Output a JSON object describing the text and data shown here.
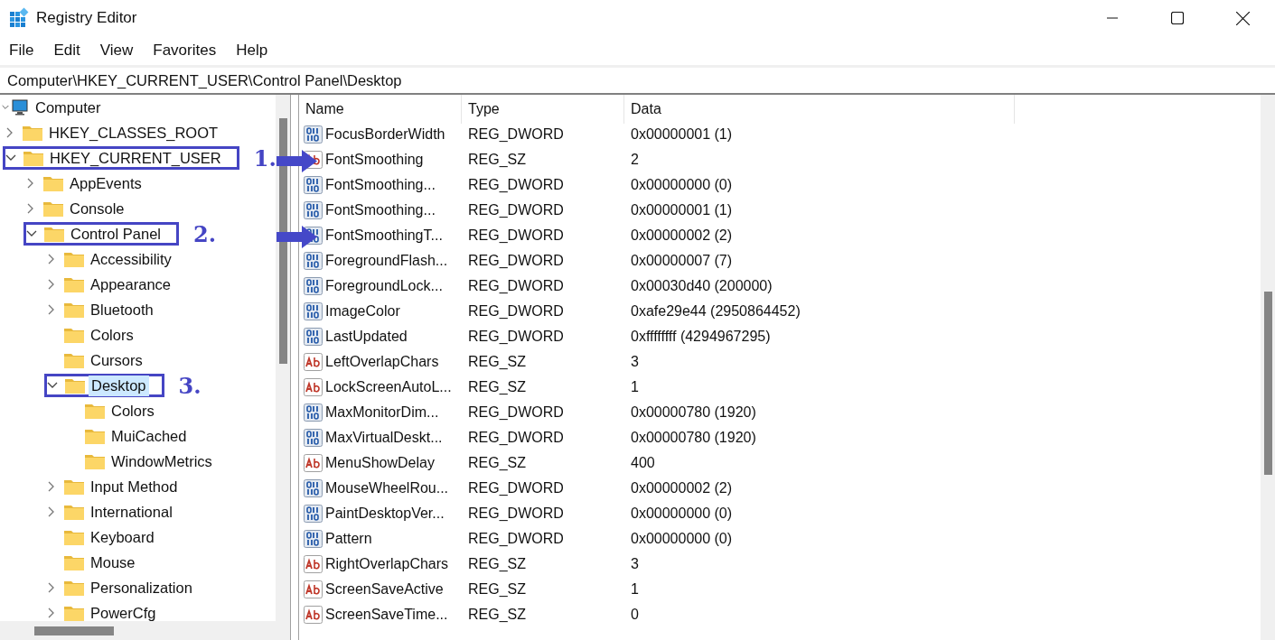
{
  "window": {
    "title": "Registry Editor"
  },
  "menu": [
    "File",
    "Edit",
    "View",
    "Favorites",
    "Help"
  ],
  "address": "Computer\\HKEY_CURRENT_USER\\Control Panel\\Desktop",
  "tree": [
    {
      "label": "Computer",
      "kind": "computer",
      "has_children": true,
      "expanded": true,
      "selected": false,
      "children": [
        {
          "label": "HKEY_CLASSES_ROOT",
          "kind": "folder",
          "has_children": true,
          "expanded": false,
          "selected": false
        },
        {
          "label": "HKEY_CURRENT_USER",
          "kind": "folder",
          "has_children": true,
          "expanded": true,
          "selected": false,
          "annotation": "1.",
          "children": [
            {
              "label": "AppEvents",
              "kind": "folder",
              "has_children": true,
              "expanded": false,
              "selected": false
            },
            {
              "label": "Console",
              "kind": "folder",
              "has_children": true,
              "expanded": false,
              "selected": false
            },
            {
              "label": "Control Panel",
              "kind": "folder",
              "has_children": true,
              "expanded": true,
              "selected": false,
              "annotation": "2.",
              "children": [
                {
                  "label": "Accessibility",
                  "kind": "folder",
                  "has_children": true,
                  "expanded": false,
                  "selected": false
                },
                {
                  "label": "Appearance",
                  "kind": "folder",
                  "has_children": true,
                  "expanded": false,
                  "selected": false
                },
                {
                  "label": "Bluetooth",
                  "kind": "folder",
                  "has_children": true,
                  "expanded": false,
                  "selected": false
                },
                {
                  "label": "Colors",
                  "kind": "folder",
                  "has_children": false,
                  "selected": false
                },
                {
                  "label": "Cursors",
                  "kind": "folder",
                  "has_children": false,
                  "selected": false
                },
                {
                  "label": "Desktop",
                  "kind": "folder",
                  "has_children": true,
                  "expanded": true,
                  "selected": true,
                  "annotation": "3.",
                  "children": [
                    {
                      "label": "Colors",
                      "kind": "folder",
                      "has_children": false,
                      "selected": false
                    },
                    {
                      "label": "MuiCached",
                      "kind": "folder",
                      "has_children": false,
                      "selected": false
                    },
                    {
                      "label": "WindowMetrics",
                      "kind": "folder",
                      "has_children": false,
                      "selected": false
                    }
                  ]
                },
                {
                  "label": "Input Method",
                  "kind": "folder",
                  "has_children": true,
                  "expanded": false,
                  "selected": false
                },
                {
                  "label": "International",
                  "kind": "folder",
                  "has_children": true,
                  "expanded": false,
                  "selected": false
                },
                {
                  "label": "Keyboard",
                  "kind": "folder",
                  "has_children": false,
                  "selected": false
                },
                {
                  "label": "Mouse",
                  "kind": "folder",
                  "has_children": false,
                  "selected": false
                },
                {
                  "label": "Personalization",
                  "kind": "folder",
                  "has_children": true,
                  "expanded": false,
                  "selected": false
                },
                {
                  "label": "PowerCfg",
                  "kind": "folder",
                  "has_children": true,
                  "expanded": false,
                  "selected": false
                }
              ]
            }
          ]
        }
      ]
    }
  ],
  "columns": [
    "Name",
    "Type",
    "Data"
  ],
  "values": [
    {
      "name": "FocusBorderWidth",
      "kind": "binary",
      "type": "REG_DWORD",
      "data": "0x00000001 (1)",
      "arrow": false
    },
    {
      "name": "FontSmoothing",
      "kind": "string",
      "type": "REG_SZ",
      "data": "2",
      "arrow": true
    },
    {
      "name": "FontSmoothing...",
      "kind": "binary",
      "type": "REG_DWORD",
      "data": "0x00000000 (0)",
      "arrow": false
    },
    {
      "name": "FontSmoothing...",
      "kind": "binary",
      "type": "REG_DWORD",
      "data": "0x00000001 (1)",
      "arrow": false
    },
    {
      "name": "FontSmoothingT...",
      "kind": "binary",
      "type": "REG_DWORD",
      "data": "0x00000002 (2)",
      "arrow": true
    },
    {
      "name": "ForegroundFlash...",
      "kind": "binary",
      "type": "REG_DWORD",
      "data": "0x00000007 (7)",
      "arrow": false
    },
    {
      "name": "ForegroundLock...",
      "kind": "binary",
      "type": "REG_DWORD",
      "data": "0x00030d40 (200000)",
      "arrow": false
    },
    {
      "name": "ImageColor",
      "kind": "binary",
      "type": "REG_DWORD",
      "data": "0xafe29e44 (2950864452)",
      "arrow": false
    },
    {
      "name": "LastUpdated",
      "kind": "binary",
      "type": "REG_DWORD",
      "data": "0xffffffff (4294967295)",
      "arrow": false
    },
    {
      "name": "LeftOverlapChars",
      "kind": "string",
      "type": "REG_SZ",
      "data": "3",
      "arrow": false
    },
    {
      "name": "LockScreenAutoL...",
      "kind": "string",
      "type": "REG_SZ",
      "data": "1",
      "arrow": false
    },
    {
      "name": "MaxMonitorDim...",
      "kind": "binary",
      "type": "REG_DWORD",
      "data": "0x00000780 (1920)",
      "arrow": false
    },
    {
      "name": "MaxVirtualDeskt...",
      "kind": "binary",
      "type": "REG_DWORD",
      "data": "0x00000780 (1920)",
      "arrow": false
    },
    {
      "name": "MenuShowDelay",
      "kind": "string",
      "type": "REG_SZ",
      "data": "400",
      "arrow": false
    },
    {
      "name": "MouseWheelRou...",
      "kind": "binary",
      "type": "REG_DWORD",
      "data": "0x00000002 (2)",
      "arrow": false
    },
    {
      "name": "PaintDesktopVer...",
      "kind": "binary",
      "type": "REG_DWORD",
      "data": "0x00000000 (0)",
      "arrow": false
    },
    {
      "name": "Pattern",
      "kind": "binary",
      "type": "REG_DWORD",
      "data": "0x00000000 (0)",
      "arrow": false
    },
    {
      "name": "RightOverlapChars",
      "kind": "string",
      "type": "REG_SZ",
      "data": "3",
      "arrow": false
    },
    {
      "name": "ScreenSaveActive",
      "kind": "string",
      "type": "REG_SZ",
      "data": "1",
      "arrow": false
    },
    {
      "name": "ScreenSaveTime...",
      "kind": "string",
      "type": "REG_SZ",
      "data": "0",
      "arrow": false
    }
  ]
}
